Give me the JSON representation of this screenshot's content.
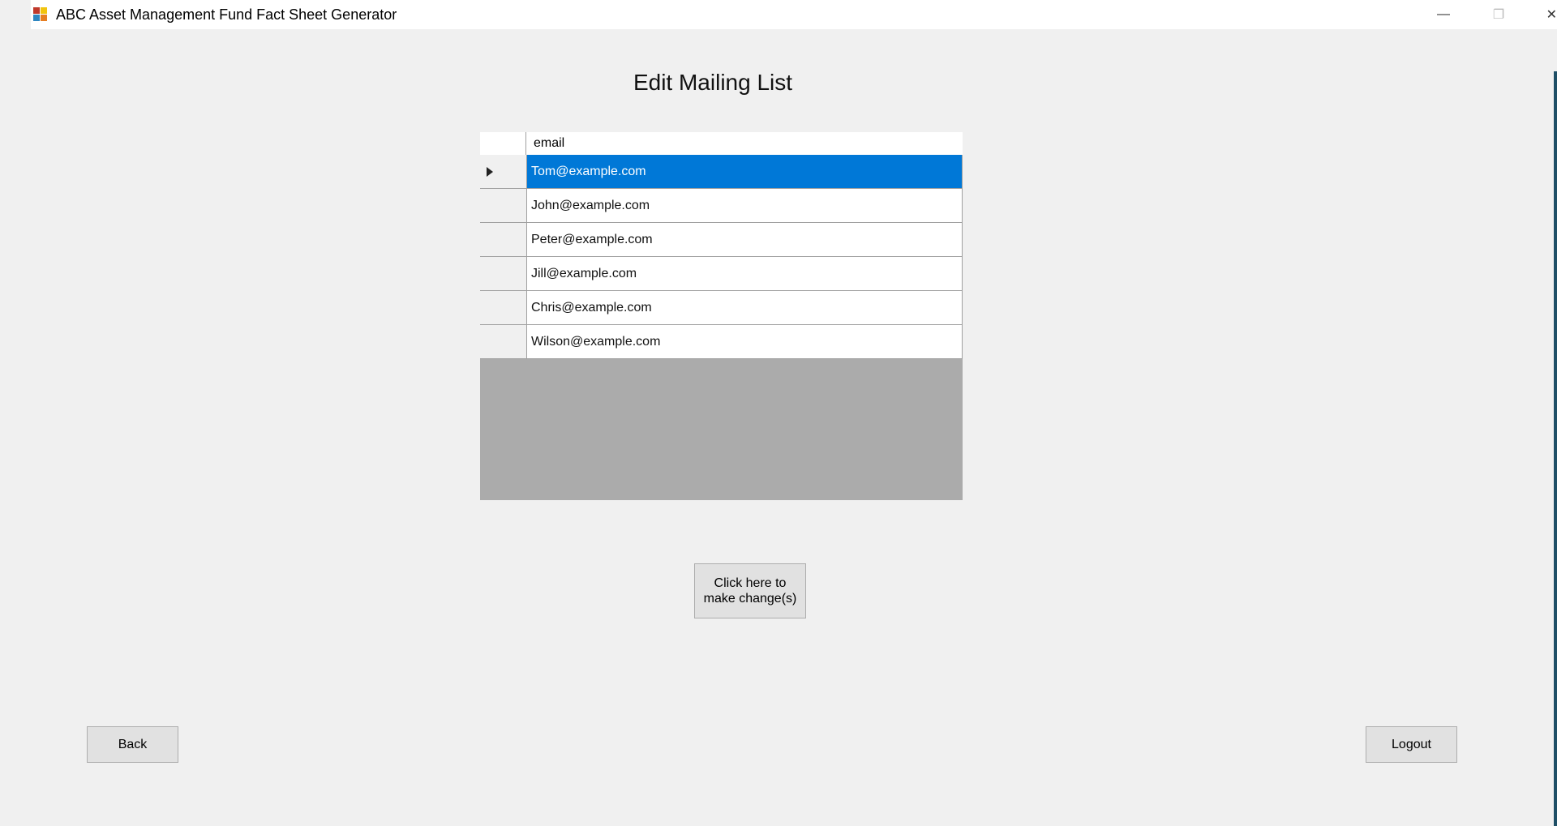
{
  "window": {
    "title": "ABC Asset Management Fund Fact Sheet Generator",
    "controls": [
      "minimize-icon",
      "restore-icon",
      "close-icon"
    ],
    "minimize_glyph": "—",
    "restore_glyph": "❐",
    "close_glyph": "✕"
  },
  "page": {
    "title": "Edit Mailing List"
  },
  "grid": {
    "column_header": "email",
    "selected_row_index": 0,
    "rows": [
      "Tom@example.com",
      "John@example.com",
      "Peter@example.com",
      "Jill@example.com",
      "Chris@example.com",
      "Wilson@example.com"
    ]
  },
  "buttons": {
    "make_change": "Click here to\nmake change(s)",
    "back": "Back",
    "logout": "Logout"
  },
  "colors": {
    "selection": "#0078d7",
    "background": "#f0f0f0",
    "grid_empty": "#ababab"
  }
}
